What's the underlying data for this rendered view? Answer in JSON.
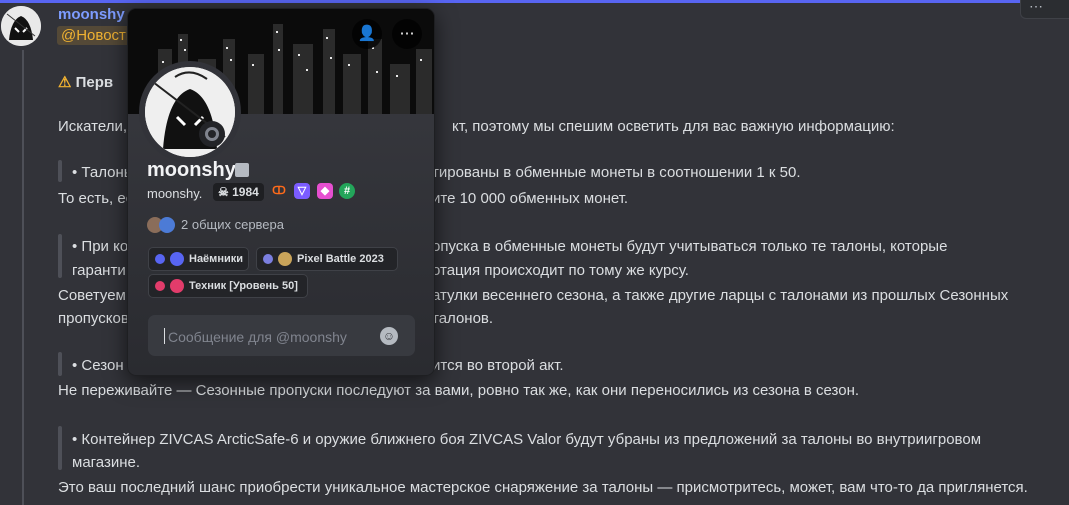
{
  "header": {
    "overflow_icon": "⋯"
  },
  "message": {
    "author": "moonshy",
    "mention": "@Новости",
    "heading": "Перв",
    "lines": [
      {
        "left": "Искатели,",
        "right": "кт, поэтому мы спешим осветить для вас важную информацию:"
      },
      {
        "quote_left": "• Талоны",
        "quote_right": "тированы в обменные монеты в соотношении 1 к 50."
      },
      {
        "left": "То есть, ес",
        "right": "ите 10 000 обменных монет."
      },
      {
        "quote_left": "•  При ко",
        "quote_right": "опуска в обменные монеты будут учитываться только те талоны, которые"
      },
      {
        "quote_left": "гаранти",
        "quote_right": "отация происходит по тому же курсу."
      },
      {
        "left": "Советуем",
        "right": "атулки весеннего сезона, а также другие ларцы с талонами из прошлых Сезонных"
      },
      {
        "left": "пропусков",
        "right": "талонов."
      },
      {
        "quote_left": "• Сезон",
        "quote_right": "ится во второй акт."
      },
      {
        "text": "Не переживайте — Сезонные пропуски последуют за вами, ровно так же, как они переносились из сезона в сезон."
      },
      {
        "quote_text": "• Контейнер ZIVCAS ArcticSafe-6 и оружие ближнего боя ZIVCAS Valor будут убраны из предложений за талоны во внутриигровом"
      },
      {
        "quote_text2": "магазине."
      },
      {
        "text2": "Это ваш последний шанс приобрести уникальное мастерское снаряжение за талоны — присмотритесь, может, вам что-то да приглянется."
      }
    ]
  },
  "profile": {
    "name": "moonshy",
    "handle": "moonshy.",
    "tag": "1984",
    "mutual_servers": "2 общих сервера",
    "roles": [
      {
        "label": "Наёмники",
        "dot_color": "#5865f2"
      },
      {
        "label": "Pixel Battle 2023",
        "dot_color": "#7b7fe0"
      },
      {
        "label": "Техник [Уровень 50]",
        "dot_color": "#e23c6b"
      }
    ],
    "message_placeholder": "Сообщение для @moonshy"
  }
}
